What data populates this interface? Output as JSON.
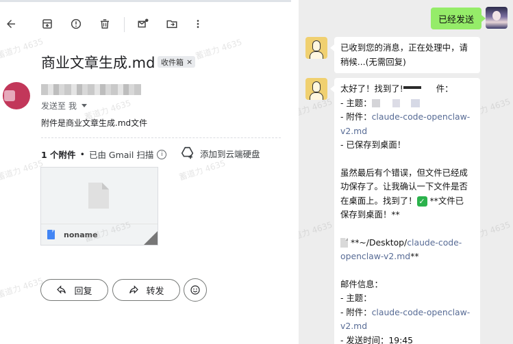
{
  "email": {
    "subject": "商业文章生成.md",
    "label": "收件箱",
    "label_close": "×",
    "send_to_prefix": "发送至",
    "send_to_value": "我",
    "body": "附件是商业文章生成.md文件",
    "attachments_count": "1 个附件",
    "attachments_separator": "•",
    "scanned_by": "已由 Gmail 扫描",
    "info_glyph": "i",
    "add_to_drive": "添加到云端硬盘",
    "attachment_name": "noname",
    "reply": "回复",
    "forward": "转发"
  },
  "toolbar_icons": [
    "back-arrow-icon",
    "archive-icon",
    "report-spam-icon",
    "delete-icon",
    "mark-unread-icon",
    "move-to-icon",
    "more-vert-icon"
  ],
  "watermark": "蓄道力 4635",
  "chat": {
    "outgoing": "已经发送",
    "msg1": {
      "line1": "已收到您的消息，正在处理中，请",
      "line2": "稍候...(无需回复)"
    },
    "msg2": {
      "l1": "太好了！找到了!",
      "l1_end": "件：",
      "subject_prefix": "- 主题：",
      "attach_prefix": "- 附件：",
      "attach_link_a": "claude-code-openclaw-",
      "attach_link_b": "v2.md",
      "saved": "- 已保存到桌面！",
      "p2_l1": "虽然最后有个错误，但文件已经成",
      "p2_l2": "功保存了。让我确认一下文件是否",
      "p2_l3": "在桌面上。找到了！",
      "check": "✓",
      "p2_l3_end": " **文件已",
      "p2_l4": "保存到桌面！**",
      "path_prefix": "**~/Desktop/",
      "path_link_a": "claude-code-",
      "path_link_b": "openclaw-v2.md",
      "path_end": "**",
      "mail_info": "邮件信息：",
      "subject_prefix2": "- 主题：",
      "attach_prefix2": "- 附件：",
      "attach_link2_a": "claude-code-openclaw-",
      "attach_link2_b": "v2.md",
      "send_time": "- 发送时间：19:45"
    }
  },
  "colors": {
    "chat_bg": "#ededed",
    "outgoing_bubble": "#95ec69",
    "link": "#576b95",
    "avatar_sender": "#c2375a",
    "bot_avatar": "#f0d070"
  }
}
